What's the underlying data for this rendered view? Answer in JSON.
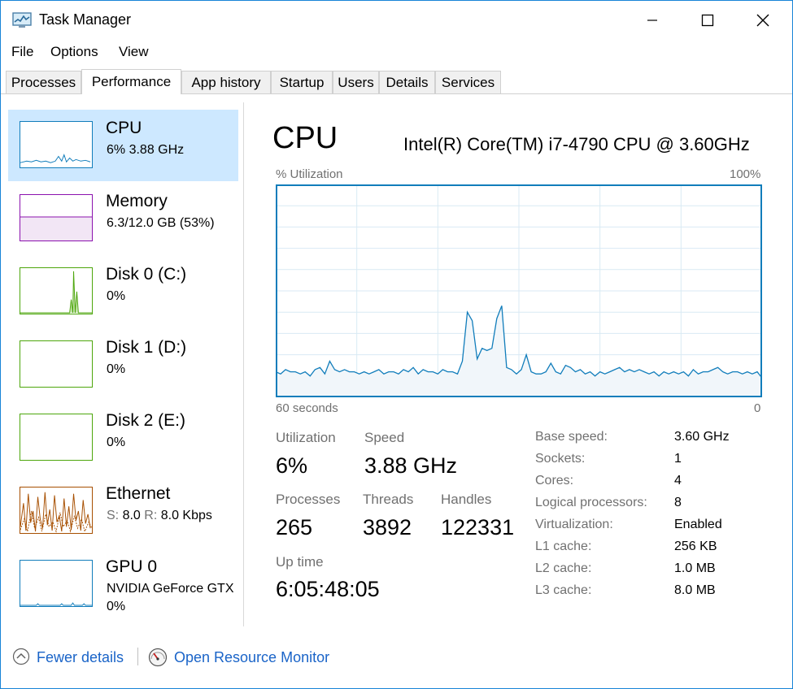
{
  "window": {
    "title": "Task Manager"
  },
  "menu": [
    "File",
    "Options",
    "View"
  ],
  "tabs": [
    "Processes",
    "Performance",
    "App history",
    "Startup",
    "Users",
    "Details",
    "Services"
  ],
  "sidebar": [
    {
      "name": "CPU",
      "detail": "6%  3.88 GHz",
      "color": "#117dbb",
      "selected": true
    },
    {
      "name": "Memory",
      "detail": "6.3/12.0 GB (53%)",
      "color": "#8b12ae"
    },
    {
      "name": "Disk 0 (C:)",
      "detail": "0%",
      "color": "#4da60c"
    },
    {
      "name": "Disk 1 (D:)",
      "detail": "0%",
      "color": "#4da60c"
    },
    {
      "name": "Disk 2 (E:)",
      "detail": "0%",
      "color": "#4da60c"
    },
    {
      "name": "Ethernet",
      "detail_s_label": "S:",
      "detail_s": "8.0",
      "detail_r_label": "R:",
      "detail_r": "8.0 Kbps",
      "color": "#a74f01"
    },
    {
      "name": "GPU 0",
      "detail": "NVIDIA GeForce GTX",
      "detail2": "0%",
      "color": "#117dbb"
    }
  ],
  "main": {
    "title": "CPU",
    "model": "Intel(R) Core(TM) i7-4790 CPU @ 3.60GHz",
    "graph_label_left": "% Utilization",
    "graph_label_right": "100%",
    "graph_time_left": "60 seconds",
    "graph_time_right": "0",
    "graph_color": "#117dbb",
    "utilization_series": [
      12,
      11,
      13,
      12,
      12,
      11,
      12,
      10,
      13,
      14,
      11,
      17,
      13,
      12,
      13,
      12,
      12,
      11,
      12,
      11,
      12,
      13,
      11,
      12,
      12,
      11,
      13,
      12,
      14,
      11,
      13,
      12,
      12,
      11,
      13,
      12,
      12,
      11,
      17,
      40,
      36,
      18,
      23,
      22,
      23,
      37,
      43,
      14,
      13,
      11,
      13,
      20,
      12,
      11,
      11,
      12,
      16,
      12,
      11,
      15,
      14,
      12,
      13,
      11,
      12,
      10,
      12,
      11,
      12,
      13,
      14,
      12,
      13,
      12,
      13,
      12,
      11,
      12,
      10,
      12,
      11,
      12,
      11,
      12,
      10,
      13,
      11,
      12,
      12,
      13,
      14,
      12,
      11,
      12,
      12,
      11,
      12,
      11,
      12,
      9
    ]
  },
  "stats": {
    "utilization_label": "Utilization",
    "utilization": "6%",
    "speed_label": "Speed",
    "speed": "3.88 GHz",
    "processes_label": "Processes",
    "processes": "265",
    "threads_label": "Threads",
    "threads": "3892",
    "handles_label": "Handles",
    "handles": "122331",
    "uptime_label": "Up time",
    "uptime": "6:05:48:05"
  },
  "info": [
    {
      "label": "Base speed:",
      "value": "3.60 GHz"
    },
    {
      "label": "Sockets:",
      "value": "1"
    },
    {
      "label": "Cores:",
      "value": "4"
    },
    {
      "label": "Logical processors:",
      "value": "8"
    },
    {
      "label": "Virtualization:",
      "value": "Enabled"
    },
    {
      "label": "L1 cache:",
      "value": "256 KB"
    },
    {
      "label": "L2 cache:",
      "value": "1.0 MB"
    },
    {
      "label": "L3 cache:",
      "value": "8.0 MB"
    }
  ],
  "footer": {
    "fewer_details": "Fewer details",
    "resource_monitor": "Open Resource Monitor"
  }
}
